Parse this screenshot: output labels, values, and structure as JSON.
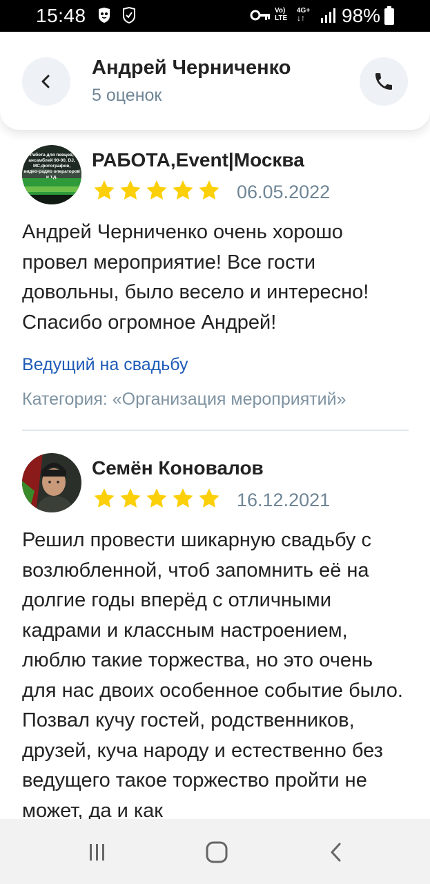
{
  "status_bar": {
    "time": "15:48",
    "net_lte_top": "Vo)",
    "net_lte_bottom": "LTE",
    "net_4g": "4G+",
    "battery": "98%"
  },
  "header": {
    "name": "Андрей Черниченко",
    "ratings_count": "5 оценок",
    "back_icon": "chevron-left-icon",
    "call_icon": "phone-icon"
  },
  "reviews": [
    {
      "author": "РАБОТА,Event|Москва",
      "rating": 5,
      "date": "06.05.2022",
      "text": "Андрей Черниченко очень хорошо провел мероприятие! Все гости довольны, было весело и интересно! Спасибо огромное Андрей!",
      "service": "Ведущий на свадьбу",
      "category": "Категория: «Организация мероприятий»",
      "avatar_text_lines": [
        "Работа для певцов,",
        "ансамблей 90-00, DJ,",
        "МС,фотографов,",
        "видео-радио операторов",
        "и т.д."
      ]
    },
    {
      "author": "Семён Коновалов",
      "rating": 5,
      "date": "16.12.2021",
      "text": "Решил провести шикарную свадьбу с возлюбленной, чтоб запомнить её на долгие годы вперёд с отличными кадрами и классным настроением, люблю такие торжества, но это очень для нас двоих особенное событие было. Позвал кучу гостей, родственников, друзей, куча народу и естественно без ведущего такое торжество пройти не может, да и как"
    }
  ],
  "colors": {
    "star": "#fcd008",
    "link": "#1e5bb7",
    "muted": "#6f8696",
    "button_bg": "#eef2f6"
  }
}
